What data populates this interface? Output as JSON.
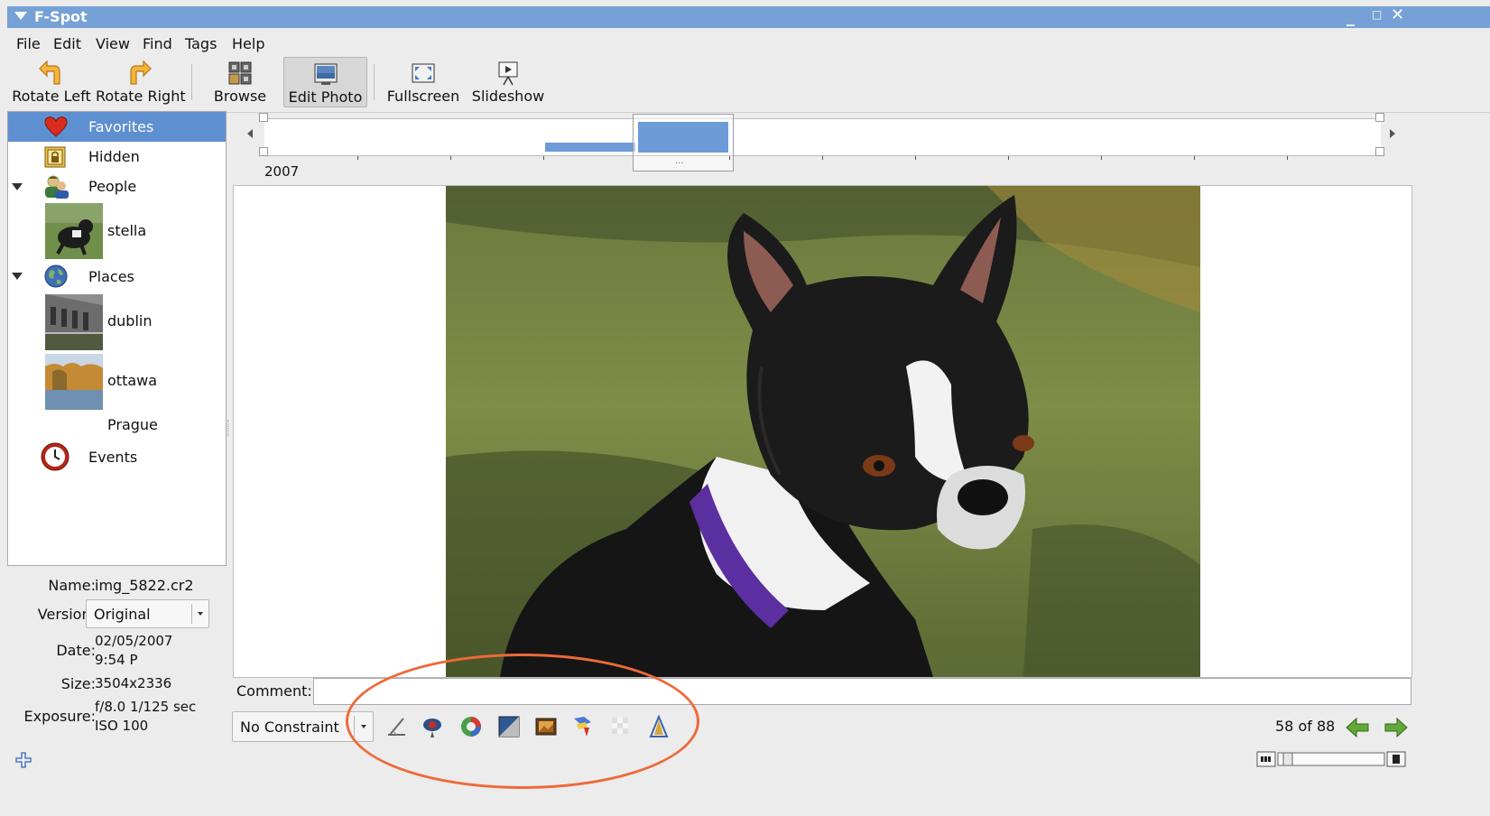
{
  "window": {
    "title": "F-Spot",
    "minimize_icon": "minimize-icon",
    "maximize_icon": "maximize-icon",
    "close_icon": "close-icon"
  },
  "menu": [
    "File",
    "Edit",
    "View",
    "Find",
    "Tags",
    "Help"
  ],
  "toolbar": {
    "rotate_left": "Rotate Left",
    "rotate_right": "Rotate Right",
    "browse": "Browse",
    "edit_photo": "Edit Photo",
    "fullscreen": "Fullscreen",
    "slideshow": "Slideshow",
    "active": "Edit Photo"
  },
  "tags": {
    "favorites": "Favorites",
    "hidden": "Hidden",
    "people": "People",
    "people_children": [
      "stella"
    ],
    "places": "Places",
    "places_children": [
      "dublin",
      "ottawa",
      "Prague"
    ],
    "events": "Events",
    "selected": "Favorites"
  },
  "timeline": {
    "year": "2007",
    "dots": "..."
  },
  "info": {
    "name_label": "Name:",
    "name": "img_5822.cr2",
    "version_label": "Version:",
    "version": "Original",
    "date_label": "Date:",
    "date": "02/05/2007",
    "time": "9:54 P",
    "size_label": "Size:",
    "size": "3504x2336",
    "exposure_label": "Exposure:",
    "exposure": "f/8.0 1/125 sec",
    "iso": "ISO 100"
  },
  "comment": {
    "label": "Comment:",
    "value": ""
  },
  "editbar": {
    "constraint": "No Constraint",
    "tools": [
      "straighten-icon",
      "red-eye-icon",
      "color-adjust-icon",
      "desaturate-icon",
      "sepia-icon",
      "soft-focus-icon",
      "tilt-icon",
      "crop-icon"
    ]
  },
  "navigation": {
    "counter": "58 of 88"
  },
  "colors": {
    "titlebar": "#76a1d6",
    "selection": "#5e8fd1",
    "annotation": "#ee6a3a"
  }
}
